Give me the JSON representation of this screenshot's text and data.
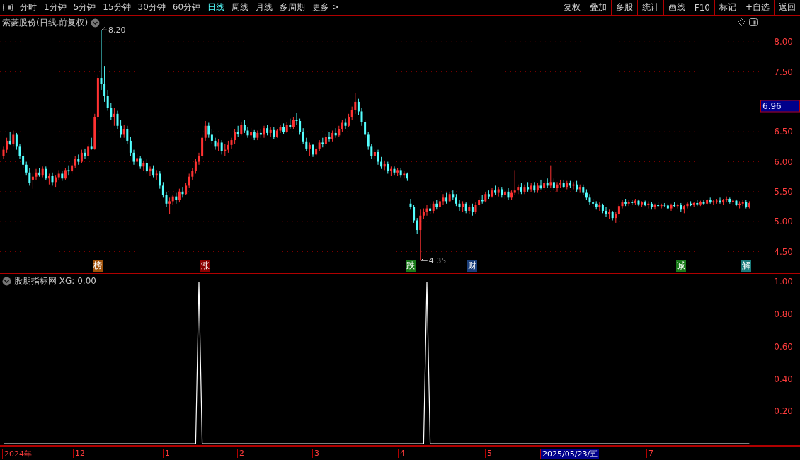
{
  "toolbar": {
    "tabs": [
      {
        "label": "分时",
        "selected": false
      },
      {
        "label": "1分钟",
        "selected": false
      },
      {
        "label": "5分钟",
        "selected": false
      },
      {
        "label": "15分钟",
        "selected": false
      },
      {
        "label": "30分钟",
        "selected": false
      },
      {
        "label": "60分钟",
        "selected": false
      },
      {
        "label": "日线",
        "selected": true
      },
      {
        "label": "周线",
        "selected": false
      },
      {
        "label": "月线",
        "selected": false
      },
      {
        "label": "多周期",
        "selected": false
      },
      {
        "label": "更多 >",
        "selected": false
      }
    ],
    "buttons": [
      "复权",
      "叠加",
      "多股",
      "统计",
      "画线",
      "F10",
      "标记",
      "+自选",
      "返回"
    ]
  },
  "price_pane": {
    "title": "索菱股份(日线.前复权)",
    "high_label": "8.20",
    "low_label": "4.35",
    "price_tag": "6.96",
    "events": [
      {
        "label": "榜",
        "color": "#a0520a"
      },
      {
        "label": "涨",
        "color": "#8b0000"
      },
      {
        "label": "跌",
        "color": "#1a7a1a"
      },
      {
        "label": "财",
        "color": "#1a3e7a"
      },
      {
        "label": "减",
        "color": "#1a7a1a"
      },
      {
        "label": "解",
        "color": "#1a7a7a"
      }
    ],
    "chart_data": {
      "type": "candlestick",
      "categories": [
        null,
        null,
        null,
        null,
        null,
        null,
        null,
        null,
        null,
        null,
        null,
        null,
        null,
        null,
        null,
        null,
        null,
        null,
        null,
        null,
        null,
        null,
        null,
        null,
        null,
        null,
        null,
        null,
        null,
        null,
        null,
        null,
        null,
        null,
        null,
        null,
        null,
        null,
        null,
        null,
        null,
        null,
        null,
        null,
        null,
        null,
        null,
        null,
        null,
        null,
        null,
        null,
        null,
        null,
        null,
        null,
        null,
        null,
        null,
        null,
        null,
        null,
        null,
        null,
        null,
        null,
        null,
        null,
        null,
        null,
        null,
        null,
        null,
        null,
        null,
        null,
        null,
        null,
        null,
        null,
        null,
        null,
        null,
        null,
        null,
        null,
        null,
        null,
        null,
        null,
        null,
        null,
        null,
        null,
        null,
        null,
        null,
        null,
        null,
        null,
        null,
        null,
        null,
        null,
        null,
        null,
        null,
        null,
        null,
        null,
        null,
        null,
        null,
        null,
        null,
        null,
        null,
        null,
        null,
        null,
        null,
        null,
        null,
        null,
        null,
        null,
        null,
        null,
        null,
        null,
        null,
        null,
        null,
        null,
        null,
        null,
        null,
        null,
        null,
        null,
        null,
        null,
        null,
        null,
        null,
        null,
        null,
        null,
        null,
        null,
        null,
        null,
        null,
        null,
        null,
        null,
        null,
        null,
        null,
        null,
        null,
        null,
        null,
        null,
        null,
        null,
        null,
        null,
        null,
        null,
        null,
        null,
        null,
        null,
        null,
        null,
        null,
        null,
        null,
        null,
        null,
        null,
        null,
        null,
        null,
        null,
        null,
        null,
        null,
        null,
        null,
        null,
        null,
        null,
        null,
        null,
        null,
        null,
        null,
        null,
        null,
        null,
        null,
        null,
        null,
        null,
        null,
        null,
        null,
        null,
        null,
        null,
        null,
        null,
        null,
        null,
        null,
        null,
        null,
        null,
        null,
        null,
        null,
        null,
        null,
        null,
        null,
        null,
        null,
        null
      ],
      "ohlc": [
        [
          6.1,
          6.25,
          6.05,
          6.2
        ],
        [
          6.2,
          6.4,
          6.15,
          6.35
        ],
        [
          6.35,
          6.5,
          6.28,
          6.3
        ],
        [
          6.3,
          6.52,
          6.25,
          6.45
        ],
        [
          6.45,
          6.48,
          6.2,
          6.25
        ],
        [
          6.25,
          6.3,
          6.05,
          6.1
        ],
        [
          6.1,
          6.15,
          5.9,
          5.95
        ],
        [
          5.95,
          6.0,
          5.78,
          5.82
        ],
        [
          5.82,
          5.9,
          5.6,
          5.65
        ],
        [
          5.7,
          5.8,
          5.55,
          5.75
        ],
        [
          5.75,
          5.88,
          5.7,
          5.82
        ],
        [
          5.82,
          5.9,
          5.75,
          5.78
        ],
        [
          5.78,
          5.92,
          5.74,
          5.88
        ],
        [
          5.88,
          5.92,
          5.7,
          5.72
        ],
        [
          5.72,
          5.8,
          5.62,
          5.76
        ],
        [
          5.76,
          5.82,
          5.6,
          5.66
        ],
        [
          5.66,
          5.78,
          5.58,
          5.74
        ],
        [
          5.74,
          5.86,
          5.7,
          5.8
        ],
        [
          5.8,
          5.84,
          5.68,
          5.72
        ],
        [
          5.72,
          5.9,
          5.7,
          5.86
        ],
        [
          5.86,
          5.94,
          5.78,
          5.84
        ],
        [
          5.84,
          5.98,
          5.8,
          5.94
        ],
        [
          5.94,
          6.1,
          5.9,
          6.05
        ],
        [
          6.05,
          6.12,
          5.95,
          6.0
        ],
        [
          6.0,
          6.2,
          5.98,
          6.15
        ],
        [
          6.15,
          6.22,
          6.05,
          6.1
        ],
        [
          6.1,
          6.3,
          6.05,
          6.25
        ],
        [
          6.25,
          6.4,
          6.2,
          6.22
        ],
        [
          6.22,
          6.8,
          6.2,
          6.75
        ],
        [
          6.75,
          7.45,
          6.7,
          7.4
        ],
        [
          7.4,
          8.2,
          7.2,
          7.3
        ],
        [
          7.3,
          7.6,
          7.0,
          7.1
        ],
        [
          7.1,
          7.2,
          6.85,
          6.9
        ],
        [
          6.9,
          6.98,
          6.7,
          6.75
        ],
        [
          6.75,
          6.9,
          6.6,
          6.8
        ],
        [
          6.8,
          6.85,
          6.55,
          6.6
        ],
        [
          6.6,
          6.7,
          6.4,
          6.45
        ],
        [
          6.45,
          6.62,
          6.4,
          6.55
        ],
        [
          6.55,
          6.6,
          6.3,
          6.35
        ],
        [
          6.35,
          6.42,
          6.1,
          6.15
        ],
        [
          6.15,
          6.2,
          5.95,
          6.0
        ],
        [
          6.0,
          6.12,
          5.92,
          6.06
        ],
        [
          6.06,
          6.1,
          5.88,
          5.92
        ],
        [
          5.92,
          6.02,
          5.85,
          5.98
        ],
        [
          5.98,
          6.04,
          5.8,
          5.84
        ],
        [
          5.84,
          5.92,
          5.76,
          5.88
        ],
        [
          5.88,
          5.94,
          5.74,
          5.78
        ],
        [
          5.78,
          5.86,
          5.7,
          5.8
        ],
        [
          5.8,
          5.84,
          5.55,
          5.6
        ],
        [
          5.6,
          5.66,
          5.4,
          5.45
        ],
        [
          5.45,
          5.5,
          5.25,
          5.3
        ],
        [
          5.3,
          5.4,
          5.12,
          5.34
        ],
        [
          5.34,
          5.45,
          5.28,
          5.42
        ],
        [
          5.42,
          5.48,
          5.3,
          5.36
        ],
        [
          5.36,
          5.55,
          5.32,
          5.5
        ],
        [
          5.5,
          5.58,
          5.4,
          5.46
        ],
        [
          5.46,
          5.65,
          5.44,
          5.6
        ],
        [
          5.6,
          5.8,
          5.56,
          5.75
        ],
        [
          5.75,
          5.9,
          5.7,
          5.85
        ],
        [
          5.85,
          6.05,
          5.8,
          6.0
        ],
        [
          6.0,
          6.15,
          5.95,
          6.1
        ],
        [
          6.1,
          6.45,
          6.05,
          6.4
        ],
        [
          6.4,
          6.68,
          6.35,
          6.6
        ],
        [
          6.6,
          6.65,
          6.4,
          6.45
        ],
        [
          6.45,
          6.55,
          6.3,
          6.35
        ],
        [
          6.35,
          6.4,
          6.2,
          6.25
        ],
        [
          6.25,
          6.38,
          6.18,
          6.32
        ],
        [
          6.32,
          6.36,
          6.12,
          6.18
        ],
        [
          6.18,
          6.3,
          6.1,
          6.2
        ],
        [
          6.2,
          6.35,
          6.15,
          6.28
        ],
        [
          6.28,
          6.4,
          6.22,
          6.36
        ],
        [
          6.36,
          6.55,
          6.3,
          6.5
        ],
        [
          6.5,
          6.6,
          6.42,
          6.46
        ],
        [
          6.46,
          6.66,
          6.44,
          6.62
        ],
        [
          6.62,
          6.7,
          6.48,
          6.52
        ],
        [
          6.52,
          6.58,
          6.4,
          6.44
        ],
        [
          6.44,
          6.56,
          6.38,
          6.5
        ],
        [
          6.5,
          6.54,
          6.36,
          6.4
        ],
        [
          6.4,
          6.52,
          6.36,
          6.48
        ],
        [
          6.48,
          6.55,
          6.4,
          6.45
        ],
        [
          6.45,
          6.6,
          6.4,
          6.56
        ],
        [
          6.56,
          6.62,
          6.44,
          6.48
        ],
        [
          6.48,
          6.58,
          6.42,
          6.54
        ],
        [
          6.54,
          6.58,
          6.38,
          6.42
        ],
        [
          6.42,
          6.55,
          6.4,
          6.52
        ],
        [
          6.52,
          6.62,
          6.48,
          6.58
        ],
        [
          6.58,
          6.64,
          6.46,
          6.5
        ],
        [
          6.5,
          6.66,
          6.48,
          6.62
        ],
        [
          6.62,
          6.72,
          6.55,
          6.58
        ],
        [
          6.58,
          6.75,
          6.55,
          6.7
        ],
        [
          6.7,
          6.82,
          6.62,
          6.68
        ],
        [
          6.68,
          6.72,
          6.45,
          6.5
        ],
        [
          6.5,
          6.56,
          6.3,
          6.34
        ],
        [
          6.34,
          6.4,
          6.18,
          6.22
        ],
        [
          6.22,
          6.32,
          6.1,
          6.28
        ],
        [
          6.28,
          6.3,
          6.08,
          6.12
        ],
        [
          6.12,
          6.26,
          6.1,
          6.22
        ],
        [
          6.22,
          6.36,
          6.18,
          6.32
        ],
        [
          6.32,
          6.4,
          6.24,
          6.3
        ],
        [
          6.3,
          6.46,
          6.26,
          6.42
        ],
        [
          6.42,
          6.5,
          6.34,
          6.38
        ],
        [
          6.38,
          6.52,
          6.34,
          6.48
        ],
        [
          6.48,
          6.56,
          6.4,
          6.44
        ],
        [
          6.44,
          6.6,
          6.42,
          6.55
        ],
        [
          6.55,
          6.7,
          6.5,
          6.65
        ],
        [
          6.65,
          6.72,
          6.55,
          6.6
        ],
        [
          6.6,
          6.8,
          6.58,
          6.75
        ],
        [
          6.75,
          6.92,
          6.7,
          6.86
        ],
        [
          6.86,
          7.15,
          6.8,
          7.0
        ],
        [
          7.0,
          7.05,
          6.78,
          6.84
        ],
        [
          6.84,
          6.9,
          6.6,
          6.66
        ],
        [
          6.66,
          6.7,
          6.4,
          6.45
        ],
        [
          6.45,
          6.5,
          6.2,
          6.25
        ],
        [
          6.25,
          6.3,
          6.05,
          6.1
        ],
        [
          6.1,
          6.22,
          6.04,
          6.16
        ],
        [
          6.16,
          6.2,
          5.95,
          6.0
        ],
        [
          6.0,
          6.08,
          5.88,
          5.92
        ],
        [
          5.92,
          6.02,
          5.86,
          5.96
        ],
        [
          5.96,
          6.0,
          5.8,
          5.85
        ],
        [
          5.85,
          5.92,
          5.76,
          5.88
        ],
        [
          5.88,
          5.92,
          5.78,
          5.82
        ],
        [
          5.82,
          5.9,
          5.76,
          5.86
        ],
        [
          5.86,
          5.9,
          5.74,
          5.78
        ],
        [
          5.78,
          5.84,
          5.72,
          5.8
        ],
        [
          5.8,
          5.82,
          5.68,
          5.72
        ],
        [
          5.3,
          5.38,
          5.2,
          5.24
        ],
        [
          5.24,
          5.28,
          4.98,
          5.02
        ],
        [
          5.02,
          5.06,
          4.8,
          4.86
        ],
        [
          4.86,
          5.2,
          4.35,
          5.1
        ],
        [
          5.1,
          5.22,
          5.04,
          5.16
        ],
        [
          5.16,
          5.28,
          5.1,
          5.22
        ],
        [
          5.22,
          5.3,
          5.12,
          5.18
        ],
        [
          5.18,
          5.34,
          5.14,
          5.3
        ],
        [
          5.3,
          5.36,
          5.2,
          5.24
        ],
        [
          5.24,
          5.38,
          5.2,
          5.34
        ],
        [
          5.34,
          5.46,
          5.28,
          5.4
        ],
        [
          5.4,
          5.48,
          5.3,
          5.34
        ],
        [
          5.34,
          5.5,
          5.32,
          5.46
        ],
        [
          5.46,
          5.52,
          5.36,
          5.4
        ],
        [
          5.4,
          5.46,
          5.26,
          5.3
        ],
        [
          5.3,
          5.36,
          5.18,
          5.24
        ],
        [
          5.24,
          5.34,
          5.16,
          5.3
        ],
        [
          5.3,
          5.32,
          5.14,
          5.18
        ],
        [
          5.18,
          5.28,
          5.12,
          5.24
        ],
        [
          5.24,
          5.3,
          5.1,
          5.16
        ],
        [
          5.16,
          5.32,
          5.12,
          5.28
        ],
        [
          5.28,
          5.4,
          5.24,
          5.36
        ],
        [
          5.36,
          5.44,
          5.3,
          5.34
        ],
        [
          5.34,
          5.5,
          5.32,
          5.46
        ],
        [
          5.46,
          5.52,
          5.38,
          5.42
        ],
        [
          5.42,
          5.56,
          5.4,
          5.52
        ],
        [
          5.52,
          5.6,
          5.44,
          5.48
        ],
        [
          5.48,
          5.58,
          5.42,
          5.54
        ],
        [
          5.54,
          5.58,
          5.4,
          5.44
        ],
        [
          5.44,
          5.54,
          5.38,
          5.5
        ],
        [
          5.5,
          5.56,
          5.36,
          5.4
        ],
        [
          5.4,
          5.52,
          5.36,
          5.48
        ],
        [
          5.48,
          5.86,
          5.44,
          5.52
        ],
        [
          5.52,
          5.62,
          5.46,
          5.58
        ],
        [
          5.58,
          5.64,
          5.46,
          5.5
        ],
        [
          5.5,
          5.62,
          5.46,
          5.58
        ],
        [
          5.58,
          5.66,
          5.5,
          5.54
        ],
        [
          5.54,
          5.64,
          5.5,
          5.6
        ],
        [
          5.6,
          5.66,
          5.48,
          5.52
        ],
        [
          5.52,
          5.64,
          5.48,
          5.6
        ],
        [
          5.6,
          5.7,
          5.54,
          5.56
        ],
        [
          5.56,
          5.68,
          5.52,
          5.64
        ],
        [
          5.64,
          5.72,
          5.56,
          5.6
        ],
        [
          5.6,
          5.94,
          5.56,
          5.66
        ],
        [
          5.66,
          5.72,
          5.52,
          5.56
        ],
        [
          5.56,
          5.66,
          5.5,
          5.62
        ],
        [
          5.62,
          5.7,
          5.56,
          5.64
        ],
        [
          5.64,
          5.7,
          5.56,
          5.58
        ],
        [
          5.58,
          5.68,
          5.54,
          5.64
        ],
        [
          5.64,
          5.68,
          5.56,
          5.6
        ],
        [
          5.6,
          5.66,
          5.54,
          5.62
        ],
        [
          5.62,
          5.68,
          5.5,
          5.54
        ],
        [
          5.54,
          5.62,
          5.48,
          5.58
        ],
        [
          5.58,
          5.62,
          5.44,
          5.48
        ],
        [
          5.48,
          5.54,
          5.36,
          5.4
        ],
        [
          5.4,
          5.46,
          5.28,
          5.32
        ],
        [
          5.32,
          5.38,
          5.24,
          5.3
        ],
        [
          5.3,
          5.34,
          5.2,
          5.24
        ],
        [
          5.24,
          5.32,
          5.18,
          5.28
        ],
        [
          5.28,
          5.3,
          5.14,
          5.18
        ],
        [
          5.18,
          5.24,
          5.08,
          5.12
        ],
        [
          5.12,
          5.2,
          5.04,
          5.16
        ],
        [
          5.16,
          5.18,
          5.02,
          5.06
        ],
        [
          5.06,
          5.16,
          4.98,
          5.12
        ],
        [
          5.12,
          5.3,
          5.08,
          5.26
        ],
        [
          5.26,
          5.36,
          5.22,
          5.32
        ],
        [
          5.32,
          5.38,
          5.26,
          5.3
        ],
        [
          5.3,
          5.36,
          5.26,
          5.33
        ],
        [
          5.33,
          5.36,
          5.28,
          5.31
        ],
        [
          5.31,
          5.38,
          5.28,
          5.35
        ],
        [
          5.35,
          5.37,
          5.26,
          5.29
        ],
        [
          5.29,
          5.34,
          5.24,
          5.32
        ],
        [
          5.32,
          5.35,
          5.26,
          5.28
        ],
        [
          5.28,
          5.34,
          5.22,
          5.3
        ],
        [
          5.3,
          5.33,
          5.2,
          5.24
        ],
        [
          5.24,
          5.3,
          5.2,
          5.28
        ],
        [
          5.28,
          5.32,
          5.24,
          5.26
        ],
        [
          5.26,
          5.3,
          5.22,
          5.28
        ],
        [
          5.28,
          5.31,
          5.24,
          5.27
        ],
        [
          5.27,
          5.3,
          5.2,
          5.22
        ],
        [
          5.22,
          5.3,
          5.18,
          5.28
        ],
        [
          5.28,
          5.32,
          5.24,
          5.26
        ],
        [
          5.26,
          5.3,
          5.22,
          5.28
        ],
        [
          5.28,
          5.31,
          5.16,
          5.2
        ],
        [
          5.2,
          5.28,
          5.14,
          5.26
        ],
        [
          5.26,
          5.32,
          5.22,
          5.3
        ],
        [
          5.3,
          5.34,
          5.26,
          5.28
        ],
        [
          5.28,
          5.33,
          5.24,
          5.31
        ],
        [
          5.31,
          5.36,
          5.26,
          5.29
        ],
        [
          5.29,
          5.35,
          5.26,
          5.33
        ],
        [
          5.33,
          5.36,
          5.28,
          5.3
        ],
        [
          5.3,
          5.38,
          5.28,
          5.36
        ],
        [
          5.36,
          5.4,
          5.3,
          5.32
        ],
        [
          5.32,
          5.36,
          5.28,
          5.34
        ],
        [
          5.34,
          5.38,
          5.3,
          5.35
        ],
        [
          5.35,
          5.4,
          5.3,
          5.32
        ],
        [
          5.32,
          5.38,
          5.28,
          5.36
        ],
        [
          5.36,
          5.42,
          5.32,
          5.38
        ],
        [
          5.38,
          5.4,
          5.3,
          5.33
        ],
        [
          5.33,
          5.38,
          5.28,
          5.35
        ],
        [
          5.35,
          5.37,
          5.26,
          5.28
        ],
        [
          5.28,
          5.34,
          5.22,
          5.3
        ],
        [
          5.3,
          5.36,
          5.26,
          5.33
        ],
        [
          5.33,
          5.36,
          5.22,
          5.25
        ],
        [
          5.25,
          5.34,
          5.22,
          5.31
        ]
      ],
      "ylim": [
        4.14,
        8.44
      ],
      "grid": true,
      "yticks": [
        {
          "value": 8,
          "label": "8.00"
        },
        {
          "value": 7.5,
          "label": "7.50"
        },
        {
          "value": 6.5,
          "label": "6.50"
        },
        {
          "value": 6,
          "label": "6.00"
        },
        {
          "value": 5.5,
          "label": "5.50"
        },
        {
          "value": 5,
          "label": "5.00"
        },
        {
          "value": 4.5,
          "label": "4.50"
        }
      ]
    }
  },
  "indicator_pane": {
    "title": "股朋指标网 XG: 0.00",
    "chart_data": {
      "type": "line",
      "categories": [
        null,
        null,
        null,
        null,
        null,
        null,
        null,
        null,
        null,
        null,
        null,
        null,
        null,
        null,
        null,
        null,
        null,
        null,
        null,
        null,
        null,
        null,
        null,
        null,
        null,
        null,
        null,
        null,
        null,
        null,
        null,
        null,
        null,
        null,
        null,
        null,
        null,
        null,
        null,
        null,
        null,
        null,
        null,
        null,
        null,
        null,
        null,
        null,
        null,
        null,
        null,
        null,
        null,
        null,
        null,
        null,
        null,
        null,
        null,
        null,
        null,
        null,
        null,
        null,
        null,
        null,
        null,
        null,
        null,
        null,
        null,
        null,
        null,
        null,
        null,
        null,
        null,
        null,
        null,
        null,
        null,
        null,
        null,
        null,
        null,
        null,
        null,
        null,
        null,
        null,
        null,
        null,
        null,
        null,
        null,
        null,
        null,
        null,
        null,
        null,
        null,
        null,
        null,
        null,
        null,
        null,
        null,
        null,
        null,
        null,
        null,
        null,
        null,
        null,
        null,
        null,
        null,
        null,
        null,
        null,
        null,
        null,
        null,
        null,
        null,
        null,
        null,
        null,
        null,
        null,
        null,
        null,
        null,
        null,
        null,
        null,
        null,
        null,
        null,
        null,
        null,
        null,
        null,
        null,
        null,
        null,
        null,
        null,
        null,
        null,
        null,
        null,
        null,
        null,
        null,
        null,
        null,
        null,
        null,
        null,
        null,
        null,
        null,
        null,
        null,
        null,
        null,
        null,
        null,
        null,
        null,
        null,
        null,
        null,
        null,
        null,
        null,
        null,
        null,
        null,
        null,
        null,
        null,
        null,
        null,
        null,
        null,
        null,
        null,
        null,
        null,
        null,
        null,
        null,
        null,
        null,
        null,
        null,
        null,
        null,
        null,
        null,
        null,
        null,
        null,
        null,
        null,
        null,
        null,
        null,
        null,
        null,
        null,
        null,
        null,
        null,
        null,
        null,
        null,
        null,
        null,
        null,
        null,
        null,
        null,
        null,
        null,
        null,
        null,
        null
      ],
      "series": [
        {
          "color": "#ffffff",
          "values": [
            0,
            0,
            0,
            0,
            0,
            0,
            0,
            0,
            0,
            0,
            0,
            0,
            0,
            0,
            0,
            0,
            0,
            0,
            0,
            0,
            0,
            0,
            0,
            0,
            0,
            0,
            0,
            0,
            0,
            0,
            0,
            0,
            0,
            0,
            0,
            0,
            0,
            0,
            0,
            0,
            0,
            0,
            0,
            0,
            0,
            0,
            0,
            0,
            0,
            0,
            0,
            0,
            0,
            0,
            0,
            0,
            0,
            0,
            0,
            0,
            1,
            0,
            0,
            0,
            0,
            0,
            0,
            0,
            0,
            0,
            0,
            0,
            0,
            0,
            0,
            0,
            0,
            0,
            0,
            0,
            0,
            0,
            0,
            0,
            0,
            0,
            0,
            0,
            0,
            0,
            0,
            0,
            0,
            0,
            0,
            0,
            0,
            0,
            0,
            0,
            0,
            0,
            0,
            0,
            0,
            0,
            0,
            0,
            0,
            0,
            0,
            0,
            0,
            0,
            0,
            0,
            0,
            0,
            0,
            0,
            0,
            0,
            0,
            0,
            0,
            0,
            0,
            0,
            0,
            0,
            1,
            0,
            0,
            0,
            0,
            0,
            0,
            0,
            0,
            0,
            0,
            0,
            0,
            0,
            0,
            0,
            0,
            0,
            0,
            0,
            0,
            0,
            0,
            0,
            0,
            0,
            0,
            0,
            0,
            0,
            0,
            0,
            0,
            0,
            0,
            0,
            0,
            0,
            0,
            0,
            0,
            0,
            0,
            0,
            0,
            0,
            0,
            0,
            0,
            0,
            0,
            0,
            0,
            0,
            0,
            0,
            0,
            0,
            0,
            0,
            0,
            0,
            0,
            0,
            0,
            0,
            0,
            0,
            0,
            0,
            0,
            0,
            0,
            0,
            0,
            0,
            0,
            0,
            0,
            0,
            0,
            0,
            0,
            0,
            0,
            0,
            0,
            0,
            0,
            0,
            0,
            0,
            0,
            0,
            0,
            0,
            0,
            0,
            0,
            0
          ]
        }
      ],
      "ylim": [
        0,
        1.05
      ],
      "yticks": [
        {
          "value": 1,
          "label": "1.00"
        },
        {
          "value": 0.8,
          "label": "0.80"
        },
        {
          "value": 0.6,
          "label": "0.60"
        },
        {
          "value": 0.4,
          "label": "0.40"
        },
        {
          "value": 0.2,
          "label": "0.20"
        }
      ]
    }
  },
  "date_axis": {
    "labels": [
      {
        "text": "2024年",
        "selected": false
      },
      {
        "text": "12",
        "selected": false
      },
      {
        "text": "1",
        "selected": false
      },
      {
        "text": "2",
        "selected": false
      },
      {
        "text": "3",
        "selected": false
      },
      {
        "text": "4",
        "selected": false
      },
      {
        "text": "5",
        "selected": false
      },
      {
        "text": "2025/05/23/五",
        "selected": true
      },
      {
        "text": "7",
        "selected": false
      }
    ]
  }
}
